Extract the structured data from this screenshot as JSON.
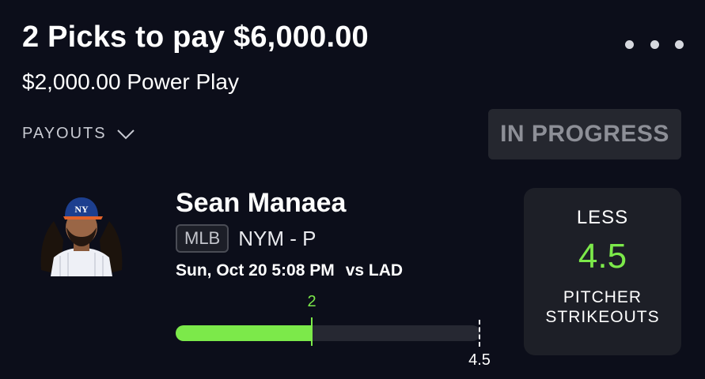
{
  "header": {
    "title": "2 Picks to pay $6,000.00",
    "subtitle": "$2,000.00 Power Play"
  },
  "payouts": {
    "label": "PAYOUTS",
    "icon": "chevron-down-icon"
  },
  "menu": {
    "icon": "more-options-icon"
  },
  "status": {
    "label": "IN PROGRESS"
  },
  "player": {
    "name": "Sean Manaea",
    "league": "MLB",
    "team_position": "NYM - P",
    "game_time": "Sun, Oct 20 5:08 PM",
    "opponent": "vs LAD"
  },
  "progress": {
    "current": "2",
    "target": "4.5",
    "current_value": 2,
    "target_value": 4.5
  },
  "pick": {
    "direction": "LESS",
    "line": "4.5",
    "stat_line1": "PITCHER",
    "stat_line2": "STRIKEOUTS"
  },
  "colors": {
    "background": "#0c0e1a",
    "accent_green": "#7ce94a",
    "card": "#1d1f27",
    "badge": "#25272f"
  }
}
